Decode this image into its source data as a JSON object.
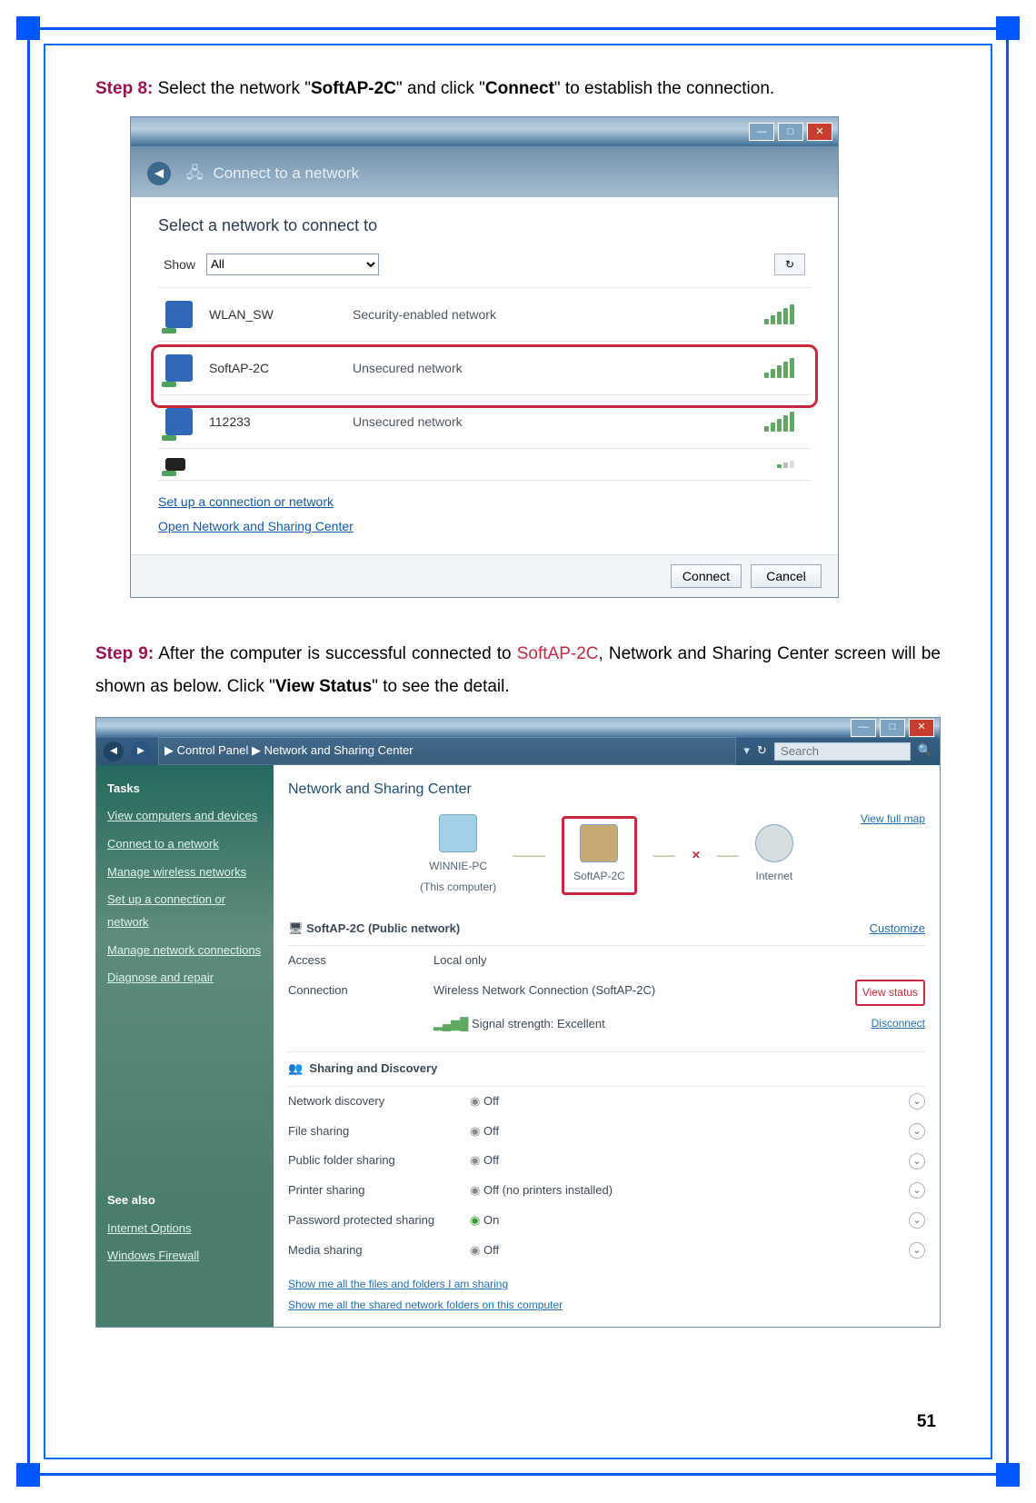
{
  "page_number": "51",
  "step8": {
    "label": "Step 8:",
    "text_a": " Select the network \"",
    "bold1": "SoftAP-2C",
    "text_b": "\" and click \"",
    "bold2": "Connect",
    "text_c": "\" to establish the connection."
  },
  "step9": {
    "label": "Step 9:",
    "text_a": " After the computer is successful connected to ",
    "red": "SoftAP-2C",
    "text_b": ", Network and Sharing Center screen will be shown as below. Click \"",
    "bold1": "View Status",
    "text_c": "\" to see the detail."
  },
  "win1": {
    "title": "Connect to a network",
    "prompt": "Select a network to connect to",
    "show_label": "Show",
    "show_value": "All",
    "networks": [
      {
        "name": "WLAN_SW",
        "sec": "Security-enabled network"
      },
      {
        "name": "SoftAP-2C",
        "sec": "Unsecured network"
      },
      {
        "name": "112233",
        "sec": "Unsecured network"
      }
    ],
    "link1": "Set up a connection or network",
    "link2": "Open Network and Sharing Center",
    "btn_connect": "Connect",
    "btn_cancel": "Cancel"
  },
  "win2": {
    "crumb": "▶  Control Panel  ▶  Network and Sharing Center",
    "search_placeholder": "Search",
    "tasks_h": "Tasks",
    "tasks": [
      "View computers and devices",
      "Connect to a network",
      "Manage wireless networks",
      "Set up a connection or network",
      "Manage network connections",
      "Diagnose and repair"
    ],
    "see_also_h": "See also",
    "see_also": [
      "Internet Options",
      "Windows Firewall"
    ],
    "main_h": "Network and Sharing Center",
    "viewfull": "View full map",
    "node_pc": "WINNIE-PC",
    "node_pc_sub": "(This computer)",
    "node_ap": "SoftAP-2C",
    "node_net": "Internet",
    "soft_head": "SoftAP-2C (Public network)",
    "customize": "Customize",
    "k_access": "Access",
    "v_access": "Local only",
    "k_conn": "Connection",
    "v_conn": "Wireless Network Connection (SoftAP-2C)",
    "sig_label": "Signal strength:  Excellent",
    "view_status": "View status",
    "disconnect": "Disconnect",
    "sd_head": "Sharing and Discovery",
    "sd": [
      {
        "k": "Network discovery",
        "v": "Off"
      },
      {
        "k": "File sharing",
        "v": "Off"
      },
      {
        "k": "Public folder sharing",
        "v": "Off"
      },
      {
        "k": "Printer sharing",
        "v": "Off (no printers installed)"
      },
      {
        "k": "Password protected sharing",
        "v": "On"
      },
      {
        "k": "Media sharing",
        "v": "Off"
      }
    ],
    "fl1": "Show me all the files and folders I am sharing",
    "fl2": "Show me all the shared network folders on this computer"
  }
}
